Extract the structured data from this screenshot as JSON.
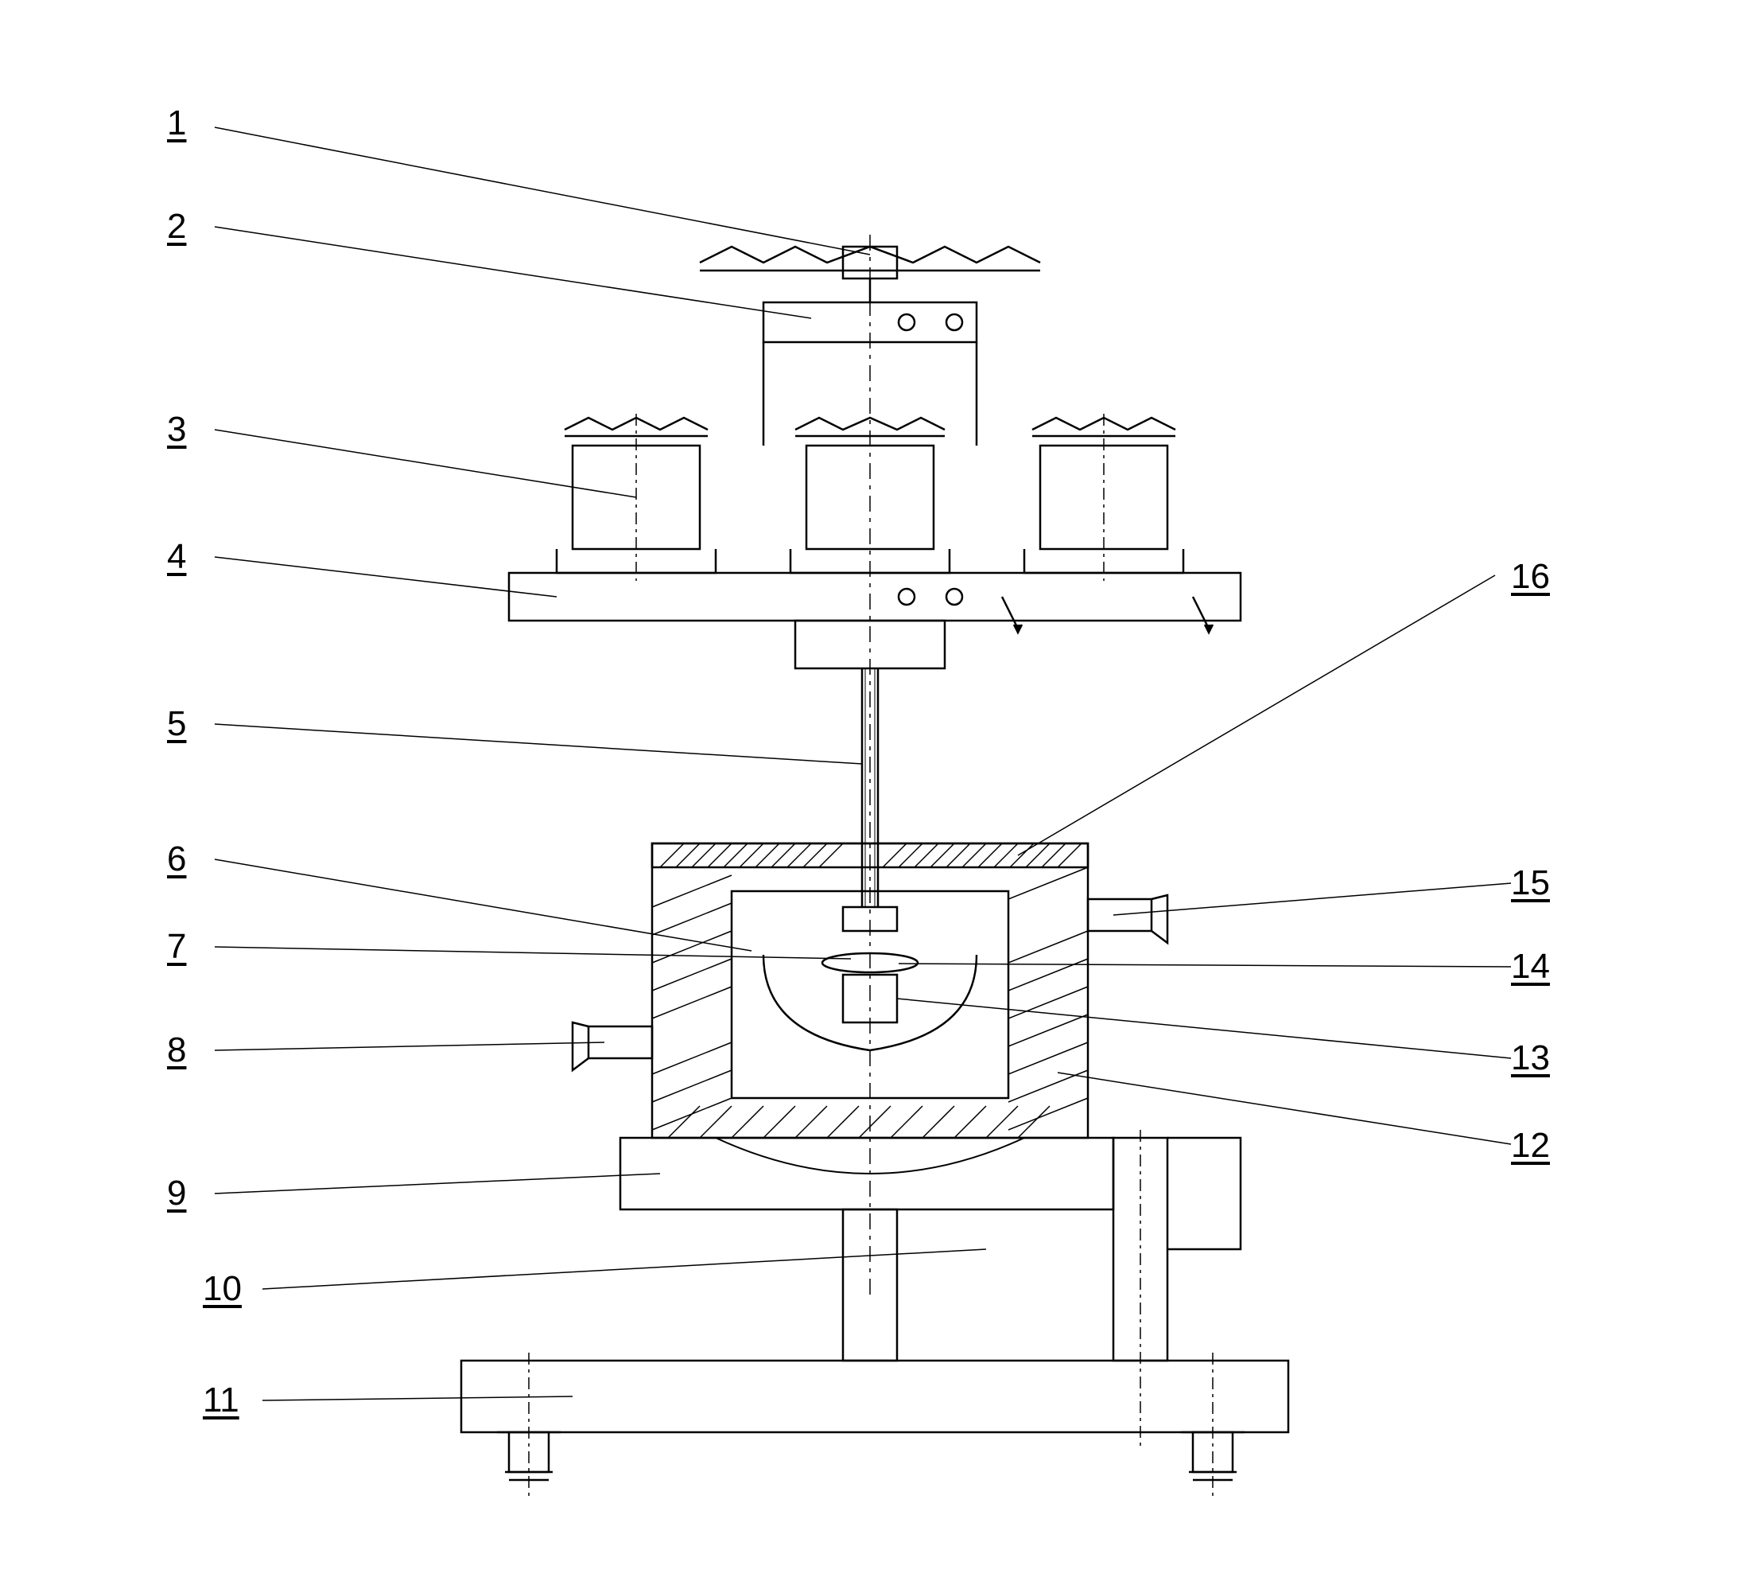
{
  "labels": {
    "l1": "1",
    "l2": "2",
    "l3": "3",
    "l4": "4",
    "l5": "5",
    "l6": "6",
    "l7": "7",
    "l8": "8",
    "l9": "9",
    "l10": "10",
    "l11": "11",
    "l12": "12",
    "l13": "13",
    "l14": "14",
    "l15": "15",
    "l16": "16"
  },
  "description": "Technical engineering cross-section drawing of mechanical apparatus with numbered callouts 1-16",
  "diagram_type": "patent_drawing"
}
